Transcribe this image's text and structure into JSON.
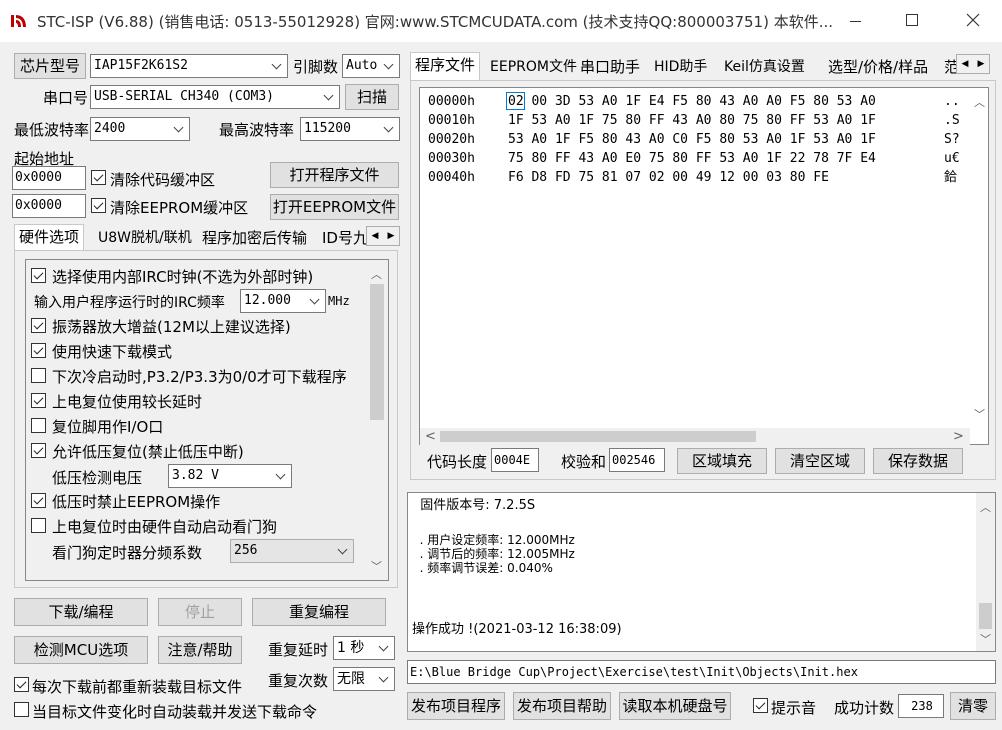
{
  "window": {
    "title": "STC-ISP (V6.88) (销售电话: 0513-55012928) 官网:www.STCMCUDATA.com  (技术支持QQ:800003751) 本软件..."
  },
  "left": {
    "chip_button": "芯片型号",
    "chip_value": "IAP15F2K61S2",
    "pins_label": "引脚数",
    "pins_value": "Auto",
    "port_label": "串口号",
    "port_value": "USB-SERIAL CH340 (COM3)",
    "scan_button": "扫描",
    "min_baud_label": "最低波特率",
    "min_baud_value": "2400",
    "max_baud_label": "最高波特率",
    "max_baud_value": "115200",
    "start_addr_label": "起始地址",
    "addr1": "0x0000",
    "clear_code_label": "清除代码缓冲区",
    "open_prog_button": "打开程序文件",
    "addr2": "0x0000",
    "clear_eeprom_label": "清除EEPROM缓冲区",
    "open_eeprom_button": "打开EEPROM文件",
    "tabs": [
      "硬件选项",
      "U8W脱机/联机",
      "程序加密后传输",
      "ID号九"
    ],
    "options": {
      "opt1": "选择使用内部IRC时钟(不选为外部时钟)",
      "irc_label": "输入用户程序运行时的IRC频率",
      "irc_value": "12.000",
      "irc_unit": "MHz",
      "opt2": "振荡器放大增益(12M以上建议选择)",
      "opt3": "使用快速下载模式",
      "opt4": "下次冷启动时,P3.2/P3.3为0/0才可下载程序",
      "opt5": "上电复位使用较长延时",
      "opt6": "复位脚用作I/O口",
      "opt7": "允许低压复位(禁止低压中断)",
      "lv_label": "低压检测电压",
      "lv_value": "3.82 V",
      "opt8": "低压时禁止EEPROM操作",
      "opt9": "上电复位时由硬件自动启动看门狗",
      "wdt_label": "看门狗定时器分频系数",
      "wdt_value": "256"
    },
    "download_button": "下载/编程",
    "stop_button": "停止",
    "reprogram_button": "重复编程",
    "check_mcu_button": "检测MCU选项",
    "help_button": "注意/帮助",
    "repeat_delay_label": "重复延时",
    "repeat_delay_value": "1 秒",
    "reload_label": "每次下载前都重新装载目标文件",
    "repeat_count_label": "重复次数",
    "repeat_count_value": "无限",
    "auto_send_label": "当目标文件变化时自动装载并发送下载命令"
  },
  "right": {
    "tabs": [
      "程序文件",
      "EEPROM文件",
      "串口助手",
      "HID助手",
      "Keil仿真设置",
      "选型/价格/样品",
      "范"
    ],
    "hex_rows": [
      {
        "addr": "00000h",
        "bytes": "02 00 3D 53 A0 1F E4 F5 80 43 A0 A0 F5 80 53 A0",
        "ascii": ".."
      },
      {
        "addr": "00010h",
        "bytes": "1F 53 A0 1F 75 80 FF 43 A0 80 75 80 FF 53 A0 1F",
        "ascii": ".S"
      },
      {
        "addr": "00020h",
        "bytes": "53 A0 1F F5 80 43 A0 C0 F5 80 53 A0 1F 53 A0 1F",
        "ascii": "S?"
      },
      {
        "addr": "00030h",
        "bytes": "75 80 FF 43 A0 E0 75 80 FF 53 A0 1F 22 78 7F E4",
        "ascii": "u€"
      },
      {
        "addr": "00040h",
        "bytes": "F6 D8 FD 75 81 07 02 00 49 12 00 03 80 FE",
        "ascii": "鉿"
      }
    ],
    "code_len_label": "代码长度",
    "code_len_value": "0004E",
    "checksum_label": "校验和",
    "checksum_value": "002546",
    "fill_button": "区域填充",
    "clear_button": "清空区域",
    "save_button": "保存数据",
    "log_lines": [
      "  固件版本号: 7.2.5S",
      "",
      "  . 用户设定频率: 12.000MHz",
      "  . 调节后的频率: 12.005MHz",
      "  . 频率调节误差: 0.040%",
      "",
      "",
      "操作成功 !(2021-03-12 16:38:09)"
    ],
    "path": "E:\\Blue Bridge Cup\\Project\\Exercise\\test\\Init\\Objects\\Init.hex",
    "publish_prog_button": "发布项目程序",
    "publish_help_button": "发布项目帮助",
    "read_disk_button": "读取本机硬盘号",
    "tip_sound_label": "提示音",
    "success_count_label": "成功计数",
    "success_count_value": "238",
    "clear_count_button": "清零"
  },
  "colors": {
    "accent": "#0078d7",
    "titlebar": "#ffffff",
    "window_bg": "#f0f0f0"
  }
}
